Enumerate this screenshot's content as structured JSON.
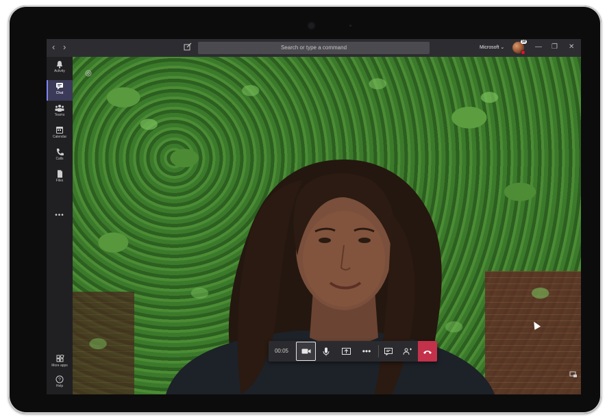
{
  "titlebar": {
    "back_glyph": "‹",
    "forward_glyph": "›",
    "compose_icon": "compose-icon",
    "search_placeholder": "Search or type a command",
    "org_label": "Microsoft",
    "org_chevron": "⌄",
    "avatar_badge": "10",
    "minimize_glyph": "—",
    "maximize_glyph": "❐",
    "close_glyph": "✕"
  },
  "rail": {
    "items": [
      {
        "label": "Activity",
        "icon": "bell-icon"
      },
      {
        "label": "Chat",
        "icon": "chat-icon"
      },
      {
        "label": "Teams",
        "icon": "teams-icon"
      },
      {
        "label": "Calendar",
        "icon": "calendar-icon"
      },
      {
        "label": "Calls",
        "icon": "phone-icon"
      },
      {
        "label": "Files",
        "icon": "file-icon"
      }
    ],
    "more": "•••",
    "bottom": [
      {
        "label": "More apps",
        "icon": "apps-icon"
      },
      {
        "label": "Help",
        "icon": "help-icon"
      }
    ]
  },
  "call": {
    "timer": "00:05",
    "controls": [
      "video-camera-icon",
      "microphone-icon",
      "share-screen-icon",
      "more-options-icon",
      "chat-icon",
      "participants-icon",
      "hang-up-icon"
    ],
    "more_glyph": "•••",
    "hangup_color": "#c4314b"
  },
  "colors": {
    "accent": "#7f85f5",
    "titlebar": "#2d2d31",
    "rail": "#202023"
  }
}
